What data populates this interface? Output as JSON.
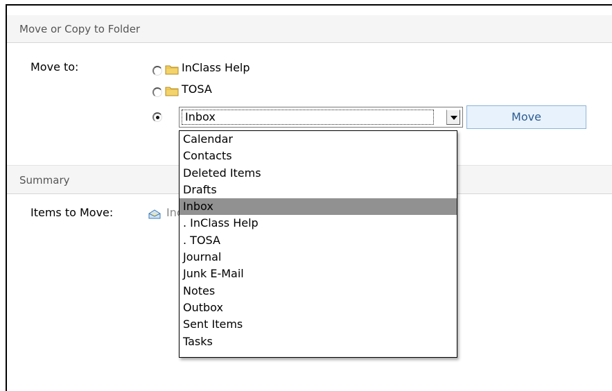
{
  "dialog": {
    "section1_title": "Move or Copy to Folder",
    "move_to_label": "Move to:",
    "options": [
      {
        "label": "InClass Help",
        "checked": false
      },
      {
        "label": "TOSA",
        "checked": false
      },
      {
        "label": "",
        "checked": true
      }
    ],
    "select_value": "Inbox",
    "move_button": "Move",
    "section2_title": "Summary",
    "items_to_move_label": "Items to Move:",
    "item_text": "Inc     ",
    "dropdown_items": [
      "Calendar",
      "Contacts",
      "Deleted Items",
      "Drafts",
      "Inbox",
      ". InClass Help",
      ". TOSA",
      "Journal",
      "Junk E-Mail",
      "Notes",
      "Outbox",
      "Sent Items",
      "Tasks"
    ],
    "selected_dropdown_index": 4
  },
  "colors": {
    "header_bg": "#f5f5f5",
    "button_bg": "#e8f2fc",
    "button_text": "#2b5c92",
    "selected_item_bg": "#919191"
  },
  "icons": {
    "folder": "folder-icon",
    "mail": "mail-icon"
  }
}
